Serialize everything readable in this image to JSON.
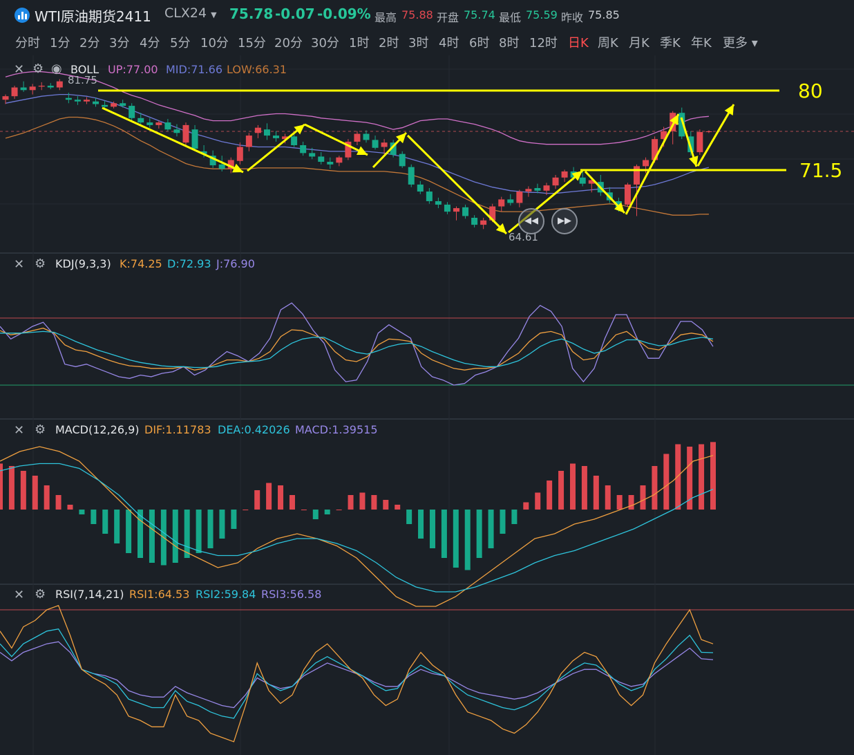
{
  "header": {
    "title": "WTI原油期货2411",
    "code": "CLX24",
    "price": "75.78",
    "change": "-0.07",
    "change_pct": "-0.09%",
    "high_label": "最高",
    "high": "75.88",
    "open_label": "开盘",
    "open": "75.74",
    "low_label": "最低",
    "low": "75.59",
    "prev_label": "昨收",
    "prev": "75.85"
  },
  "timeframes": [
    "分时",
    "1分",
    "2分",
    "3分",
    "4分",
    "5分",
    "10分",
    "15分",
    "20分",
    "30分",
    "1时",
    "2时",
    "3时",
    "4时",
    "6时",
    "8时",
    "12时",
    "日K",
    "周K",
    "月K",
    "季K",
    "年K",
    "更多"
  ],
  "active_timeframe": "日K",
  "boll": {
    "name": "BOLL",
    "up_label": "UP:77.00",
    "mid_label": "MID:71.66",
    "low_label": "LOW:66.31",
    "max_marker": "81.75",
    "min_marker": "64.61"
  },
  "annotations": {
    "level_high": "80",
    "level_mid": "71.5"
  },
  "kdj": {
    "name": "KDJ(9,3,3)",
    "k_label": "K:74.25",
    "d_label": "D:72.93",
    "j_label": "J:76.90"
  },
  "macd": {
    "name": "MACD(12,26,9)",
    "dif_label": "DIF:1.11783",
    "dea_label": "DEA:0.42026",
    "macd_label": "MACD:1.39515"
  },
  "rsi": {
    "name": "RSI(7,14,21)",
    "rsi1_label": "RSI1:64.53",
    "rsi2_label": "RSI2:59.84",
    "rsi3_label": "RSI3:56.58"
  },
  "colors": {
    "up": "#e04850",
    "down": "#16a98a",
    "boll_up": "#d070c8",
    "boll_mid": "#6d79d6",
    "boll_low": "#c47838",
    "k": "#f0a040",
    "d": "#2ec4dc",
    "j": "#9888e8",
    "dif": "#f0a040",
    "dea": "#2ec4dc",
    "annotation": "#ffff00",
    "price_change": "#27c79a"
  },
  "icons": [
    "close-icon",
    "gear-icon",
    "eye-icon",
    "chevron-down-icon",
    "skip-back-icon",
    "skip-forward-icon"
  ],
  "chart_data": {
    "type": "candlestick",
    "x": [
      0,
      1,
      2,
      3,
      4,
      5,
      6,
      7,
      8,
      9,
      10,
      11,
      12,
      13,
      14,
      15,
      16,
      17,
      18,
      19,
      20,
      21,
      22,
      23,
      24,
      25,
      26,
      27,
      28,
      29,
      30,
      31,
      32,
      33,
      34,
      35,
      36,
      37,
      38,
      39,
      40,
      41,
      42,
      43,
      44,
      45,
      46,
      47,
      48,
      49,
      50,
      51,
      52,
      53,
      54,
      55,
      56,
      57,
      58,
      59,
      60,
      61,
      62,
      63,
      64,
      65,
      66,
      67,
      68,
      69,
      70,
      71,
      72,
      73,
      74,
      75,
      76,
      77,
      78
    ],
    "candles": [
      [
        79.4,
        80.0,
        78.9,
        79.8
      ],
      [
        79.8,
        81.0,
        79.5,
        80.8
      ],
      [
        80.8,
        81.5,
        80.3,
        80.5
      ],
      [
        80.5,
        81.2,
        80.0,
        80.9
      ],
      [
        80.9,
        81.4,
        80.5,
        81.0
      ],
      [
        81.0,
        81.3,
        80.6,
        80.8
      ],
      [
        80.8,
        81.75,
        80.5,
        81.5
      ],
      [
        79.6,
        80.2,
        79.0,
        79.4
      ],
      [
        79.4,
        79.8,
        78.8,
        79.2
      ],
      [
        79.2,
        79.7,
        78.9,
        79.4
      ],
      [
        79.2,
        79.6,
        78.6,
        78.9
      ],
      [
        78.8,
        79.3,
        78.4,
        78.6
      ],
      [
        78.6,
        79.2,
        78.4,
        79.0
      ],
      [
        79.0,
        79.4,
        78.5,
        78.7
      ],
      [
        78.7,
        79.0,
        77.0,
        77.3
      ],
      [
        77.3,
        77.9,
        76.6,
        76.8
      ],
      [
        76.8,
        77.3,
        76.2,
        76.5
      ],
      [
        76.5,
        77.0,
        76.1,
        76.8
      ],
      [
        76.8,
        77.2,
        75.8,
        76.0
      ],
      [
        76.0,
        76.6,
        75.2,
        75.6
      ],
      [
        74.5,
        76.8,
        74.2,
        76.5
      ],
      [
        76.0,
        76.5,
        73.6,
        73.8
      ],
      [
        73.5,
        74.2,
        72.8,
        73.2
      ],
      [
        73.0,
        73.6,
        71.6,
        71.9
      ],
      [
        72.0,
        73.0,
        71.2,
        71.5
      ],
      [
        71.5,
        72.8,
        71.0,
        72.5
      ],
      [
        72.4,
        74.5,
        72.0,
        74.0
      ],
      [
        74.0,
        75.6,
        73.5,
        75.3
      ],
      [
        75.6,
        76.5,
        75.0,
        76.2
      ],
      [
        76.0,
        76.7,
        74.8,
        75.3
      ],
      [
        75.3,
        75.8,
        74.6,
        75.0
      ],
      [
        74.9,
        75.5,
        74.4,
        75.2
      ],
      [
        75.2,
        75.6,
        74.0,
        74.2
      ],
      [
        74.2,
        74.6,
        73.0,
        73.3
      ],
      [
        73.3,
        73.9,
        72.6,
        72.9
      ],
      [
        72.9,
        73.4,
        72.0,
        72.3
      ],
      [
        72.3,
        72.8,
        71.5,
        72.0
      ],
      [
        72.2,
        73.0,
        71.8,
        72.8
      ],
      [
        72.8,
        74.9,
        72.5,
        74.6
      ],
      [
        74.6,
        75.8,
        74.2,
        75.5
      ],
      [
        75.5,
        75.9,
        74.5,
        74.8
      ],
      [
        74.8,
        75.3,
        73.7,
        73.9
      ],
      [
        74.0,
        74.9,
        73.2,
        74.5
      ],
      [
        74.5,
        74.8,
        72.8,
        73.1
      ],
      [
        73.2,
        73.5,
        71.6,
        71.8
      ],
      [
        71.7,
        72.0,
        69.4,
        69.7
      ],
      [
        69.7,
        70.1,
        68.6,
        68.9
      ],
      [
        68.9,
        69.3,
        67.5,
        67.8
      ],
      [
        67.8,
        68.2,
        67.0,
        67.4
      ],
      [
        67.4,
        67.7,
        66.3,
        66.6
      ],
      [
        66.6,
        67.2,
        65.6,
        67.0
      ],
      [
        67.1,
        67.4,
        65.8,
        66.1
      ],
      [
        65.9,
        66.2,
        64.8,
        65.1
      ],
      [
        65.1,
        65.9,
        64.61,
        65.6
      ],
      [
        65.6,
        67.5,
        65.4,
        67.2
      ],
      [
        67.2,
        68.3,
        66.6,
        68.0
      ],
      [
        68.0,
        68.6,
        67.3,
        67.6
      ],
      [
        67.6,
        69.1,
        67.1,
        68.9
      ],
      [
        68.9,
        69.5,
        68.3,
        69.2
      ],
      [
        69.3,
        69.8,
        68.7,
        69.0
      ],
      [
        69.0,
        69.9,
        68.5,
        69.6
      ],
      [
        69.6,
        70.8,
        69.2,
        70.5
      ],
      [
        70.5,
        71.4,
        70.0,
        71.2
      ],
      [
        71.2,
        71.7,
        70.2,
        70.5
      ],
      [
        70.5,
        71.2,
        69.5,
        69.8
      ],
      [
        69.8,
        70.5,
        68.8,
        70.2
      ],
      [
        70.0,
        70.8,
        68.4,
        68.8
      ],
      [
        68.8,
        69.4,
        67.6,
        67.9
      ],
      [
        67.8,
        68.2,
        66.6,
        67.0
      ],
      [
        67.4,
        69.9,
        67.1,
        69.7
      ],
      [
        69.7,
        72.0,
        66.1,
        71.8
      ],
      [
        71.8,
        72.8,
        71.0,
        72.5
      ],
      [
        72.5,
        75.2,
        72.2,
        74.9
      ],
      [
        74.9,
        76.3,
        74.0,
        75.8
      ],
      [
        75.8,
        78.1,
        74.3,
        77.9
      ],
      [
        77.9,
        78.5,
        74.9,
        75.2
      ],
      [
        75.2,
        75.8,
        73.0,
        73.4
      ],
      [
        73.4,
        76.0,
        73.1,
        75.7
      ],
      [
        75.7,
        75.88,
        75.59,
        75.78
      ]
    ],
    "boll_up": [
      82.0,
      82.3,
      82.5,
      82.6,
      82.6,
      82.5,
      82.4,
      82.2,
      82.0,
      81.8,
      81.6,
      81.2,
      80.8,
      80.3,
      79.9,
      79.6,
      79.2,
      78.8,
      78.5,
      78.2,
      77.9,
      77.6,
      77.2,
      77.0,
      77.0,
      77.0,
      77.2,
      77.4,
      77.6,
      77.7,
      77.8,
      77.8,
      77.7,
      77.6,
      77.5,
      77.3,
      77.2,
      77.1,
      77.0,
      76.9,
      76.8,
      76.6,
      76.3,
      76.0,
      76.2,
      76.6,
      77.0,
      77.1,
      77.2,
      77.2,
      77.0,
      76.8,
      76.6,
      76.3,
      76.0,
      75.6,
      75.1,
      74.7,
      74.5,
      74.4,
      74.3,
      74.3,
      74.3,
      74.3,
      74.3,
      74.3,
      74.3,
      74.4,
      74.5,
      74.7,
      74.9,
      75.2,
      75.6,
      76.0,
      76.4,
      76.8,
      77.2,
      77.4,
      77.5
    ],
    "boll_mid": [
      79.0,
      79.2,
      79.4,
      79.6,
      79.8,
      79.9,
      80.0,
      80.0,
      79.9,
      79.8,
      79.6,
      79.3,
      79.0,
      78.6,
      78.2,
      77.8,
      77.4,
      77.0,
      76.6,
      76.2,
      75.8,
      75.5,
      75.2,
      74.9,
      74.6,
      74.4,
      74.2,
      74.1,
      74.0,
      74.0,
      74.0,
      74.0,
      73.9,
      73.8,
      73.7,
      73.6,
      73.5,
      73.5,
      73.5,
      73.5,
      73.5,
      73.4,
      73.3,
      73.1,
      72.9,
      72.6,
      72.3,
      72.0,
      71.6,
      71.2,
      70.8,
      70.4,
      70.0,
      69.7,
      69.4,
      69.2,
      69.0,
      68.9,
      68.8,
      68.8,
      68.7,
      68.7,
      68.8,
      68.9,
      69.0,
      69.1,
      69.2,
      69.3,
      69.3,
      69.3,
      69.4,
      69.5,
      69.7,
      70.0,
      70.3,
      70.7,
      71.1,
      71.4,
      71.66
    ],
    "boll_low": [
      75.0,
      75.3,
      75.6,
      76.0,
      76.4,
      76.8,
      77.2,
      77.4,
      77.4,
      77.3,
      77.1,
      76.8,
      76.4,
      75.9,
      75.3,
      74.7,
      74.2,
      73.6,
      73.1,
      72.6,
      72.1,
      71.8,
      71.6,
      71.5,
      71.5,
      71.5,
      71.5,
      71.5,
      71.6,
      71.6,
      71.6,
      71.6,
      71.6,
      71.6,
      71.5,
      71.4,
      71.3,
      71.2,
      71.2,
      71.2,
      71.2,
      71.2,
      71.2,
      71.1,
      71.0,
      70.8,
      70.5,
      70.1,
      69.6,
      69.1,
      68.6,
      68.1,
      67.6,
      67.2,
      66.8,
      66.6,
      66.6,
      66.6,
      66.6,
      66.7,
      66.8,
      66.9,
      67.0,
      67.1,
      67.2,
      67.3,
      67.4,
      67.5,
      67.4,
      67.2,
      67.0,
      66.8,
      66.6,
      66.4,
      66.2,
      66.2,
      66.2,
      66.3,
      66.31
    ],
    "kdj_k": [
      65,
      60,
      62,
      65,
      68,
      62,
      48,
      42,
      40,
      35,
      30,
      26,
      23,
      22,
      20,
      20,
      20,
      22,
      18,
      20,
      25,
      30,
      30,
      28,
      32,
      40,
      58,
      66,
      65,
      60,
      55,
      40,
      30,
      28,
      34,
      48,
      55,
      54,
      52,
      38,
      30,
      25,
      20,
      18,
      20,
      20,
      22,
      30,
      38,
      52,
      62,
      64,
      60,
      40,
      30,
      32,
      46,
      60,
      64,
      54,
      44,
      42,
      50,
      60,
      62,
      60,
      52
    ],
    "kdj_d": [
      62,
      62,
      62,
      63,
      64,
      63,
      58,
      52,
      47,
      42,
      38,
      34,
      30,
      27,
      25,
      23,
      22,
      22,
      21,
      21,
      22,
      25,
      27,
      28,
      29,
      32,
      42,
      50,
      55,
      57,
      57,
      51,
      44,
      39,
      37,
      41,
      46,
      49,
      50,
      46,
      40,
      35,
      30,
      26,
      24,
      22,
      22,
      25,
      29,
      37,
      46,
      52,
      55,
      50,
      43,
      38,
      41,
      48,
      54,
      54,
      50,
      47,
      48,
      52,
      55,
      57,
      55
    ],
    "kdj_j": [
      70,
      55,
      62,
      70,
      75,
      60,
      25,
      22,
      25,
      20,
      15,
      10,
      8,
      12,
      10,
      14,
      16,
      22,
      12,
      18,
      30,
      40,
      35,
      28,
      38,
      56,
      90,
      98,
      85,
      65,
      50,
      18,
      4,
      6,
      28,
      62,
      72,
      64,
      56,
      22,
      10,
      6,
      0,
      2,
      12,
      16,
      22,
      40,
      56,
      82,
      95,
      88,
      70,
      20,
      4,
      20,
      56,
      84,
      84,
      55,
      32,
      32,
      54,
      76,
      76,
      66,
      46
    ],
    "macd_hist": [
      0.95,
      0.9,
      0.8,
      0.7,
      0.5,
      0.3,
      0.1,
      -0.1,
      -0.3,
      -0.5,
      -0.7,
      -0.9,
      -1.0,
      -1.1,
      -1.15,
      -1.1,
      -1.0,
      -0.9,
      -0.8,
      -0.6,
      -0.4,
      0.0,
      0.4,
      0.55,
      0.5,
      0.3,
      0.0,
      -0.2,
      -0.1,
      0.0,
      0.3,
      0.35,
      0.3,
      0.2,
      0.1,
      -0.3,
      -0.6,
      -0.8,
      -1.0,
      -1.2,
      -1.25,
      -1.0,
      -0.8,
      -0.5,
      -0.3,
      0.15,
      0.35,
      0.6,
      0.8,
      0.95,
      0.9,
      0.7,
      0.5,
      0.3,
      0.3,
      0.5,
      0.9,
      1.15,
      1.35,
      1.3,
      1.35,
      1.39515
    ],
    "macd_dif": [
      1.0,
      1.2,
      1.3,
      1.2,
      1.0,
      0.6,
      0.2,
      -0.2,
      -0.5,
      -0.8,
      -1.0,
      -1.2,
      -1.1,
      -0.8,
      -0.6,
      -0.5,
      -0.6,
      -0.75,
      -1.0,
      -1.4,
      -1.8,
      -2.0,
      -2.0,
      -1.8,
      -1.5,
      -1.2,
      -0.9,
      -0.6,
      -0.5,
      -0.3,
      -0.2,
      -0.05,
      0.1,
      0.3,
      0.6,
      1.0,
      1.11783
    ],
    "macd_dea": [
      0.8,
      0.9,
      0.95,
      0.95,
      0.85,
      0.6,
      0.3,
      -0.1,
      -0.4,
      -0.7,
      -0.85,
      -0.95,
      -0.95,
      -0.85,
      -0.7,
      -0.6,
      -0.6,
      -0.7,
      -0.85,
      -1.1,
      -1.4,
      -1.6,
      -1.7,
      -1.7,
      -1.6,
      -1.45,
      -1.3,
      -1.1,
      -0.95,
      -0.85,
      -0.7,
      -0.55,
      -0.4,
      -0.2,
      0.0,
      0.25,
      0.42026
    ],
    "rsi1": [
      70,
      62,
      72,
      75,
      80,
      82,
      68,
      52,
      48,
      45,
      40,
      30,
      28,
      25,
      25,
      40,
      30,
      28,
      22,
      20,
      18,
      35,
      55,
      42,
      36,
      40,
      52,
      60,
      64,
      58,
      52,
      48,
      40,
      35,
      38,
      52,
      60,
      54,
      50,
      40,
      32,
      30,
      28,
      24,
      22,
      26,
      32,
      40,
      50,
      56,
      60,
      58,
      50,
      40,
      35,
      40,
      55,
      64,
      72,
      80,
      66,
      64
    ],
    "rsi2": [
      64,
      58,
      64,
      67,
      70,
      71,
      62,
      52,
      50,
      48,
      45,
      38,
      36,
      34,
      34,
      42,
      37,
      35,
      32,
      30,
      29,
      38,
      50,
      45,
      42,
      44,
      50,
      55,
      58,
      55,
      52,
      49,
      45,
      42,
      43,
      50,
      54,
      51,
      49,
      44,
      40,
      38,
      36,
      34,
      33,
      35,
      38,
      43,
      48,
      52,
      55,
      54,
      50,
      45,
      42,
      44,
      52,
      57,
      63,
      68,
      60,
      59.84
    ],
    "rsi3": [
      60,
      56,
      60,
      62,
      64,
      65,
      60,
      52,
      50,
      49,
      47,
      42,
      40,
      39,
      39,
      44,
      41,
      39,
      37,
      35,
      34,
      40,
      48,
      45,
      43,
      44,
      49,
      52,
      55,
      53,
      51,
      49,
      46,
      44,
      44,
      49,
      52,
      50,
      49,
      46,
      43,
      41,
      40,
      39,
      38,
      39,
      41,
      44,
      47,
      50,
      52,
      52,
      49,
      46,
      44,
      45,
      50,
      54,
      58,
      62,
      57,
      56.58
    ]
  }
}
